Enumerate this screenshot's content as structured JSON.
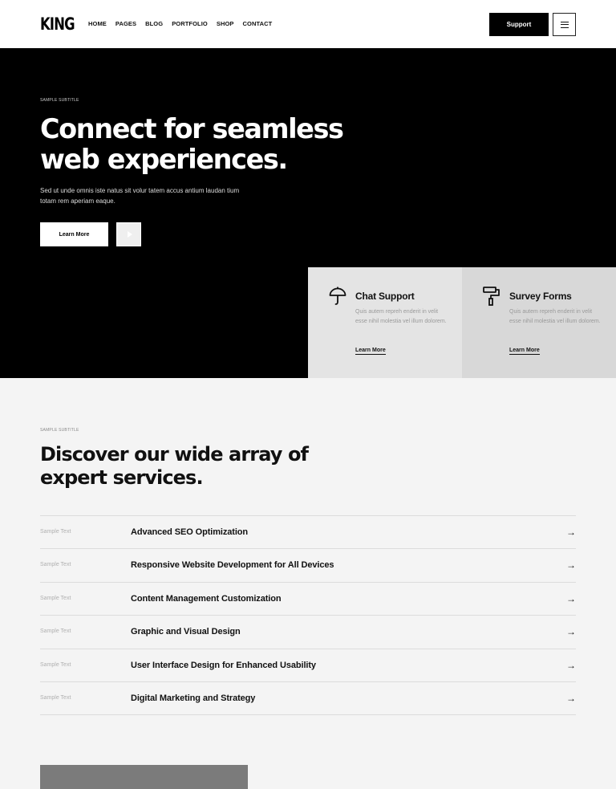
{
  "header": {
    "logo": "KING",
    "nav": [
      "HOME",
      "PAGES",
      "BLOG",
      "PORTFOLIO",
      "SHOP",
      "CONTACT"
    ],
    "support_label": "Support",
    "menu_icon": "hamburger-menu-icon"
  },
  "hero": {
    "subtitle": "SAMPLE SUBTITLE",
    "title": "Connect for seamless web experiences.",
    "description": "Sed ut unde omnis iste natus sit volur tatem accus antium laudan tium totam rem aperiam eaque.",
    "learn_more_label": "Learn More",
    "play_icon": "play-icon"
  },
  "cards": [
    {
      "icon": "umbrella-icon",
      "title": "Chat Support",
      "text": "Quis autem repreh enderit in velit esse nihil molestia vel illum dolorem.",
      "link": "Learn More"
    },
    {
      "icon": "paint-roller-icon",
      "title": "Survey Forms",
      "text": "Quis autem repreh enderit in velit esse nihil molestia vel illum dolorem.",
      "link": "Learn More"
    }
  ],
  "services": {
    "subtitle": "SAMPLE SUBTITLE",
    "title": "Discover our wide array of expert services.",
    "rows": [
      {
        "label": "Sample Text",
        "name": "Advanced SEO Optimization"
      },
      {
        "label": "Sample Text",
        "name": "Responsive Website Development for All Devices"
      },
      {
        "label": "Sample Text",
        "name": "Content Management Customization"
      },
      {
        "label": "Sample Text",
        "name": "Graphic and Visual Design"
      },
      {
        "label": "Sample Text",
        "name": "User Interface Design for Enhanced Usability"
      },
      {
        "label": "Sample Text",
        "name": "Digital Marketing and Strategy"
      }
    ],
    "arrow_glyph": "→",
    "arrow_icon": "arrow-right-icon"
  },
  "colors": {
    "hero_bg": "#000000",
    "page_bg": "#f4f4f4",
    "card1_bg": "#e4e4e4",
    "card2_bg": "#d8d8d8",
    "accent": "#000000"
  }
}
